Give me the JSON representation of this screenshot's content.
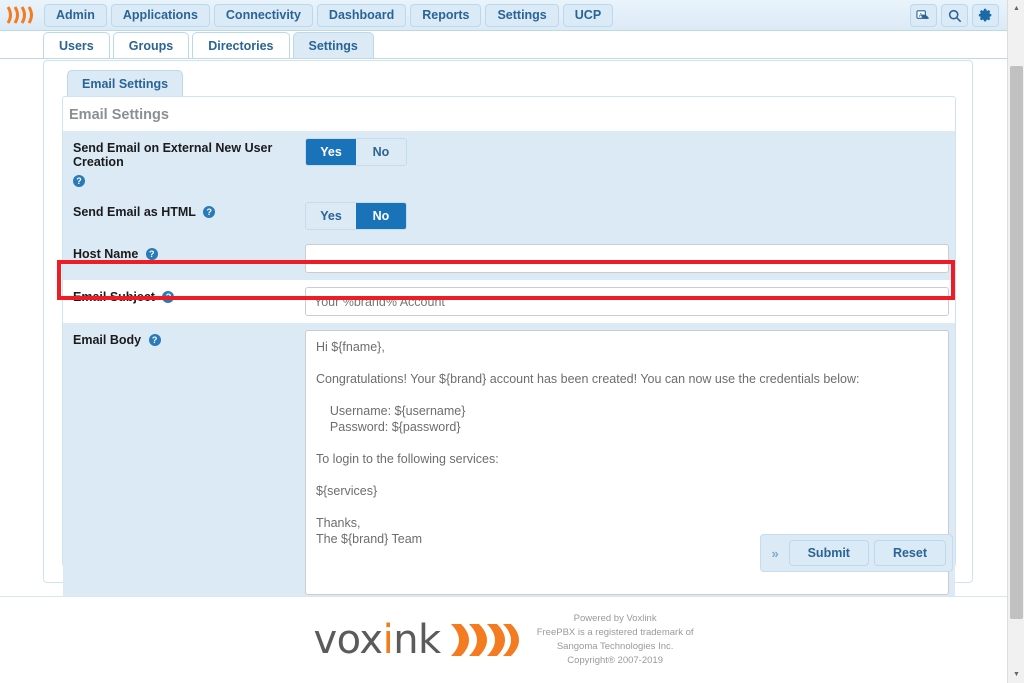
{
  "topnav": {
    "logo_icon": "freepbx-waves-logo",
    "items": [
      {
        "label": "Admin"
      },
      {
        "label": "Applications"
      },
      {
        "label": "Connectivity"
      },
      {
        "label": "Dashboard"
      },
      {
        "label": "Reports"
      },
      {
        "label": "Settings"
      },
      {
        "label": "UCP"
      }
    ],
    "right_icons": [
      {
        "name": "language-icon"
      },
      {
        "name": "search-icon"
      },
      {
        "name": "gear-icon"
      }
    ]
  },
  "subtabs": [
    {
      "label": "Users",
      "active": false
    },
    {
      "label": "Groups",
      "active": false
    },
    {
      "label": "Directories",
      "active": false
    },
    {
      "label": "Settings",
      "active": true
    }
  ],
  "inner_tab": {
    "label": "Email Settings"
  },
  "section": {
    "title": "Email Settings"
  },
  "form": {
    "send_email_external": {
      "label": "Send Email on External New User Creation",
      "yes": "Yes",
      "no": "No",
      "selected": "Yes"
    },
    "send_email_html": {
      "label": "Send Email as HTML",
      "yes": "Yes",
      "no": "No",
      "selected": "No"
    },
    "host_name": {
      "label": "Host Name",
      "value": "",
      "placeholder": ""
    },
    "email_subject": {
      "label": "Email Subject",
      "value": "Your %brand% Account",
      "highlighted": true
    },
    "email_body": {
      "label": "Email Body",
      "value": "Hi ${fname},\n\nCongratulations! Your ${brand} account has been created! You can now use the credentials below:\n\n    Username: ${username}\n    Password: ${password}\n\nTo login to the following services:\n\n${services}\n\nThanks,\nThe ${brand} Team"
    }
  },
  "actions": {
    "expand_icon": "»",
    "submit": "Submit",
    "reset": "Reset"
  },
  "footer": {
    "logo_text": "voxlink",
    "logo_icon": "voxlink-waves-logo",
    "lines": [
      "Powered by Voxlink",
      "FreePBX is a registered trademark of",
      "Sangoma Technologies Inc.",
      "Copyright® 2007-2019"
    ]
  },
  "annotation": {
    "color": "#ee1c25",
    "target": "email-subject-row"
  },
  "colors": {
    "accent_blue": "#1a73b8",
    "link_blue": "#2a6496",
    "row_bg": "#dceaf5",
    "brand_orange": "#f07d1b",
    "highlight_red": "#ee1c25"
  }
}
